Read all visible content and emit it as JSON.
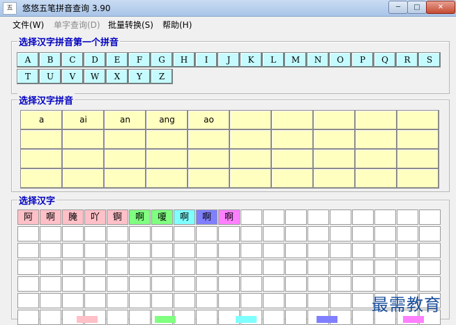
{
  "window": {
    "title": "悠悠五笔拼音查询 3.90",
    "icon": "app-icon",
    "min_icon": "minimize-icon",
    "max_icon": "maximize-icon",
    "close_icon": "close-icon"
  },
  "menu": [
    {
      "label": "文件(W)",
      "enabled": true
    },
    {
      "label": "单字查询(D)",
      "enabled": false
    },
    {
      "label": "批量转换(S)",
      "enabled": true
    },
    {
      "label": "帮助(H)",
      "enabled": true
    }
  ],
  "letters_group": {
    "title": "选择汉字拼音第一个拼音",
    "letters": [
      "A",
      "B",
      "C",
      "D",
      "E",
      "F",
      "G",
      "H",
      "I",
      "J",
      "K",
      "L",
      "M",
      "N",
      "O",
      "P",
      "Q",
      "R",
      "S",
      "T",
      "U",
      "V",
      "W",
      "X",
      "Y",
      "Z"
    ]
  },
  "pinyin_group": {
    "title": "选择汉字拼音",
    "rows": [
      [
        "a",
        "ai",
        "an",
        "ang",
        "ao",
        "",
        "",
        "",
        "",
        ""
      ],
      [
        "",
        "",
        "",
        "",
        "",
        "",
        "",
        "",
        "",
        ""
      ],
      [
        "",
        "",
        "",
        "",
        "",
        "",
        "",
        "",
        "",
        ""
      ],
      [
        "",
        "",
        "",
        "",
        "",
        "",
        "",
        "",
        "",
        ""
      ]
    ]
  },
  "chars_group": {
    "title": "选择汉字",
    "chars": [
      {
        "text": "阿",
        "color": "#ffc0c8"
      },
      {
        "text": "啊",
        "color": "#ffc0c8"
      },
      {
        "text": "腌",
        "color": "#ffc0c8"
      },
      {
        "text": "吖",
        "color": "#ffc0c8"
      },
      {
        "text": "锕",
        "color": "#ffc0c8"
      },
      {
        "text": "啊",
        "color": "#80ff80"
      },
      {
        "text": "嗄",
        "color": "#80ff80"
      },
      {
        "text": "啊",
        "color": "#80ffff"
      },
      {
        "text": "啊",
        "color": "#8080ff"
      },
      {
        "text": "啊",
        "color": "#ff80ff"
      }
    ]
  },
  "watermark": "最需教育",
  "legend_colors": [
    "#ffc0c8",
    "#80ff80",
    "#80ffff",
    "#8080ff",
    "#ff80ff"
  ]
}
